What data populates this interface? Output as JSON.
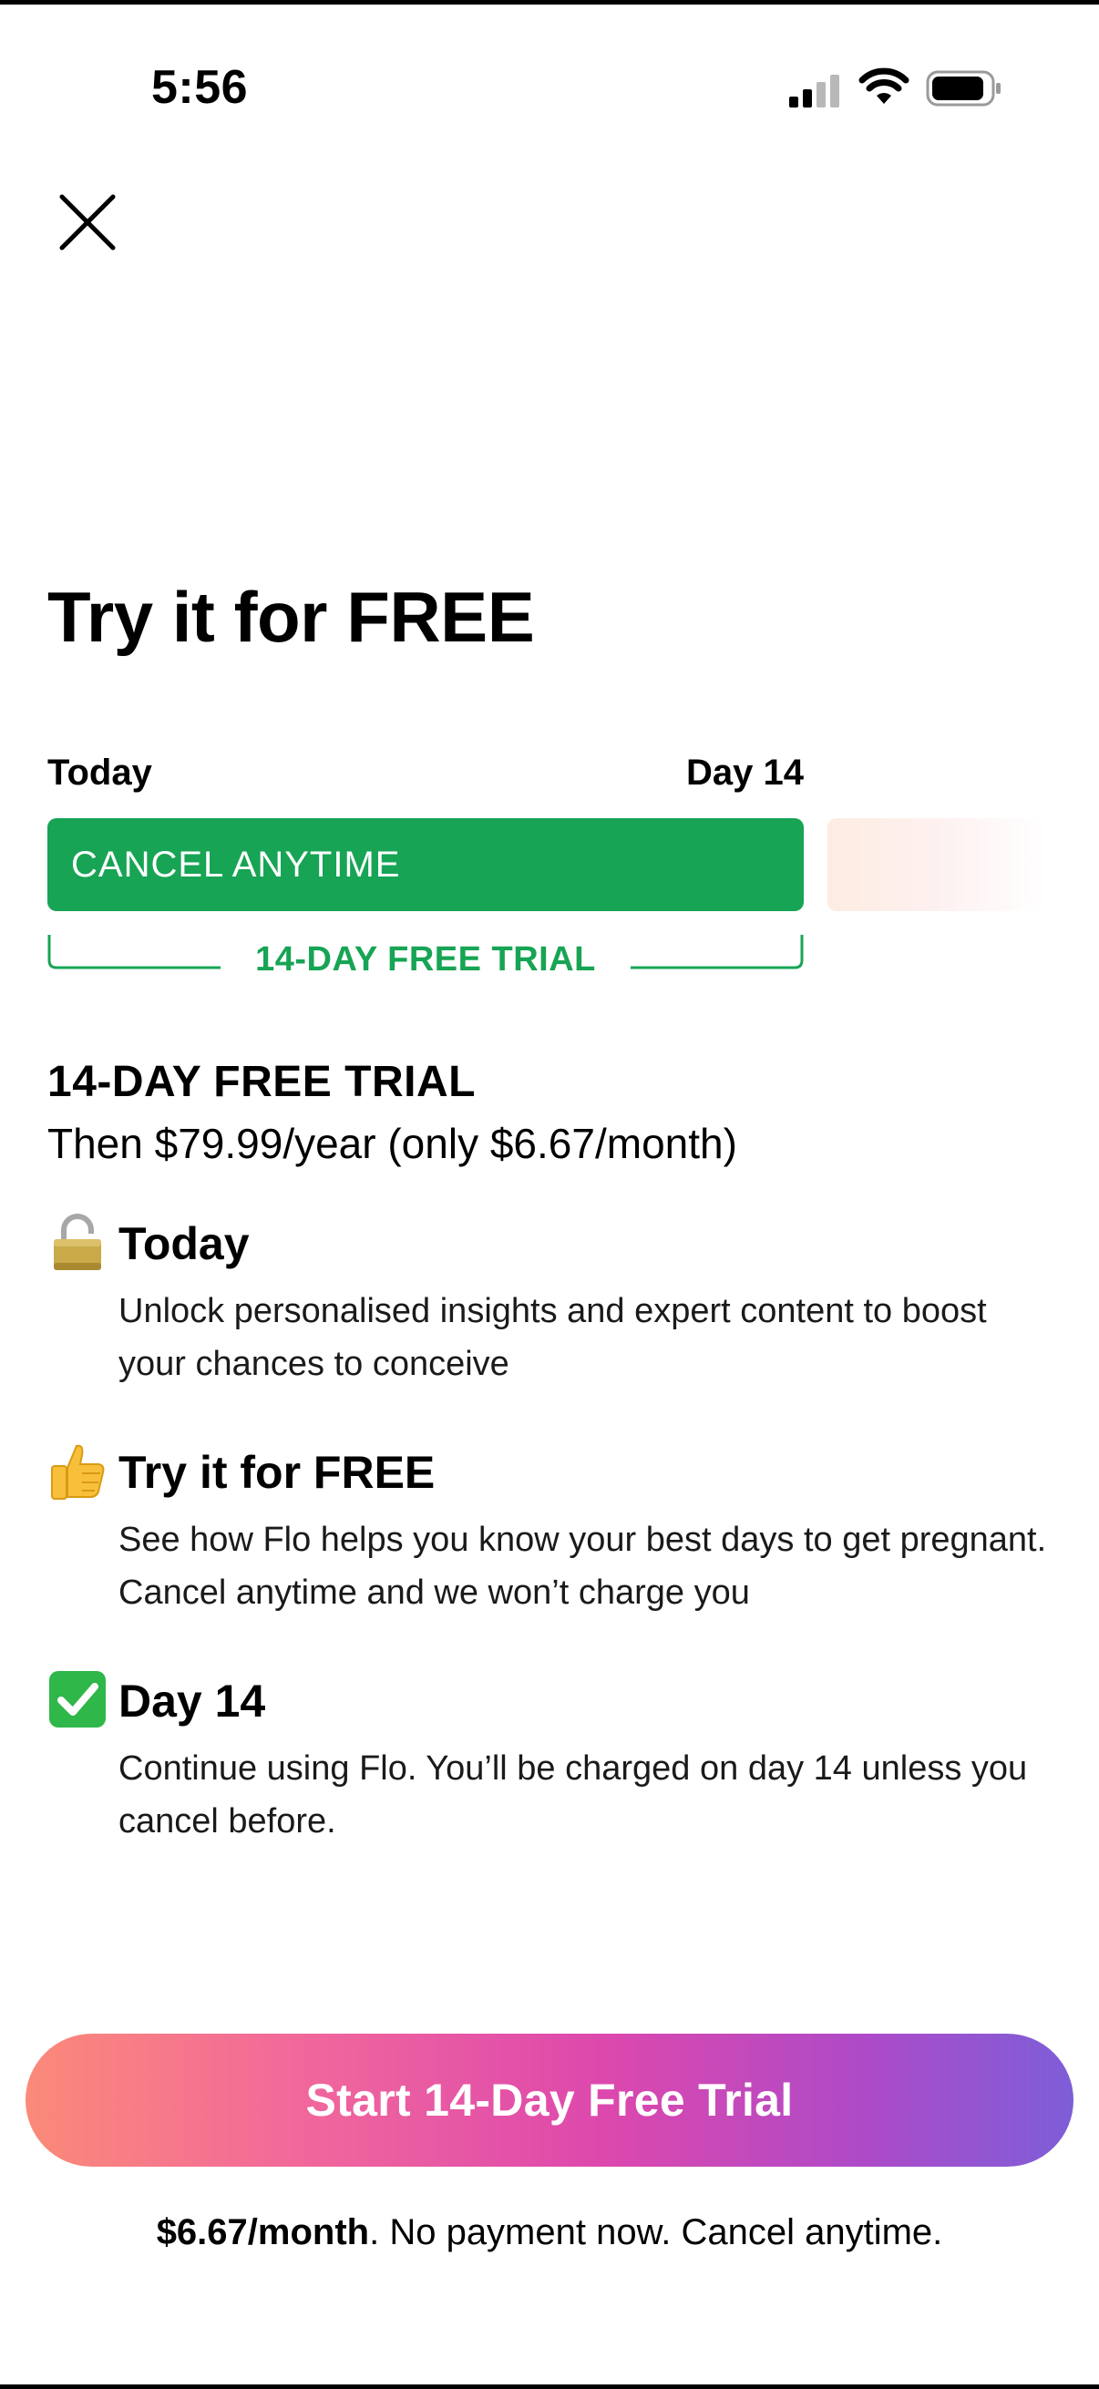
{
  "status_bar": {
    "time": "5:56",
    "icons": [
      "signal-icon",
      "wifi-icon",
      "battery-icon"
    ]
  },
  "close_icon": "close-icon",
  "title": "Try it for FREE",
  "timeline": {
    "start_label": "Today",
    "end_label": "Day 14",
    "bar_label": "CANCEL ANYTIME",
    "bracket_label": "14-DAY FREE TRIAL",
    "bar_color": "#17a454"
  },
  "offer": {
    "heading": "14-DAY FREE TRIAL",
    "price_line": "Then $79.99/year (only $6.67/month)"
  },
  "steps": [
    {
      "icon": "padlock-icon",
      "title": "Today",
      "description": "Unlock personalised insights and expert content to boost your chances to conceive"
    },
    {
      "icon": "thumbs-up-icon",
      "title": "Try it for FREE",
      "description": "See how Flo helps you know your best days to get pregnant. Cancel anytime and we won’t charge you"
    },
    {
      "icon": "check-mark-icon",
      "title": "Day 14",
      "description": "Continue using Flo. You’ll be charged on day 14 unless you cancel before."
    }
  ],
  "cta": {
    "label": "Start 14-Day Free Trial",
    "gradient": [
      "#fb8a78",
      "#f2699a",
      "#dd48ad",
      "#ae4ac8",
      "#7d5ed8"
    ]
  },
  "footnote": {
    "bold": "$6.67/month",
    "rest": ". No payment now. Cancel anytime."
  }
}
